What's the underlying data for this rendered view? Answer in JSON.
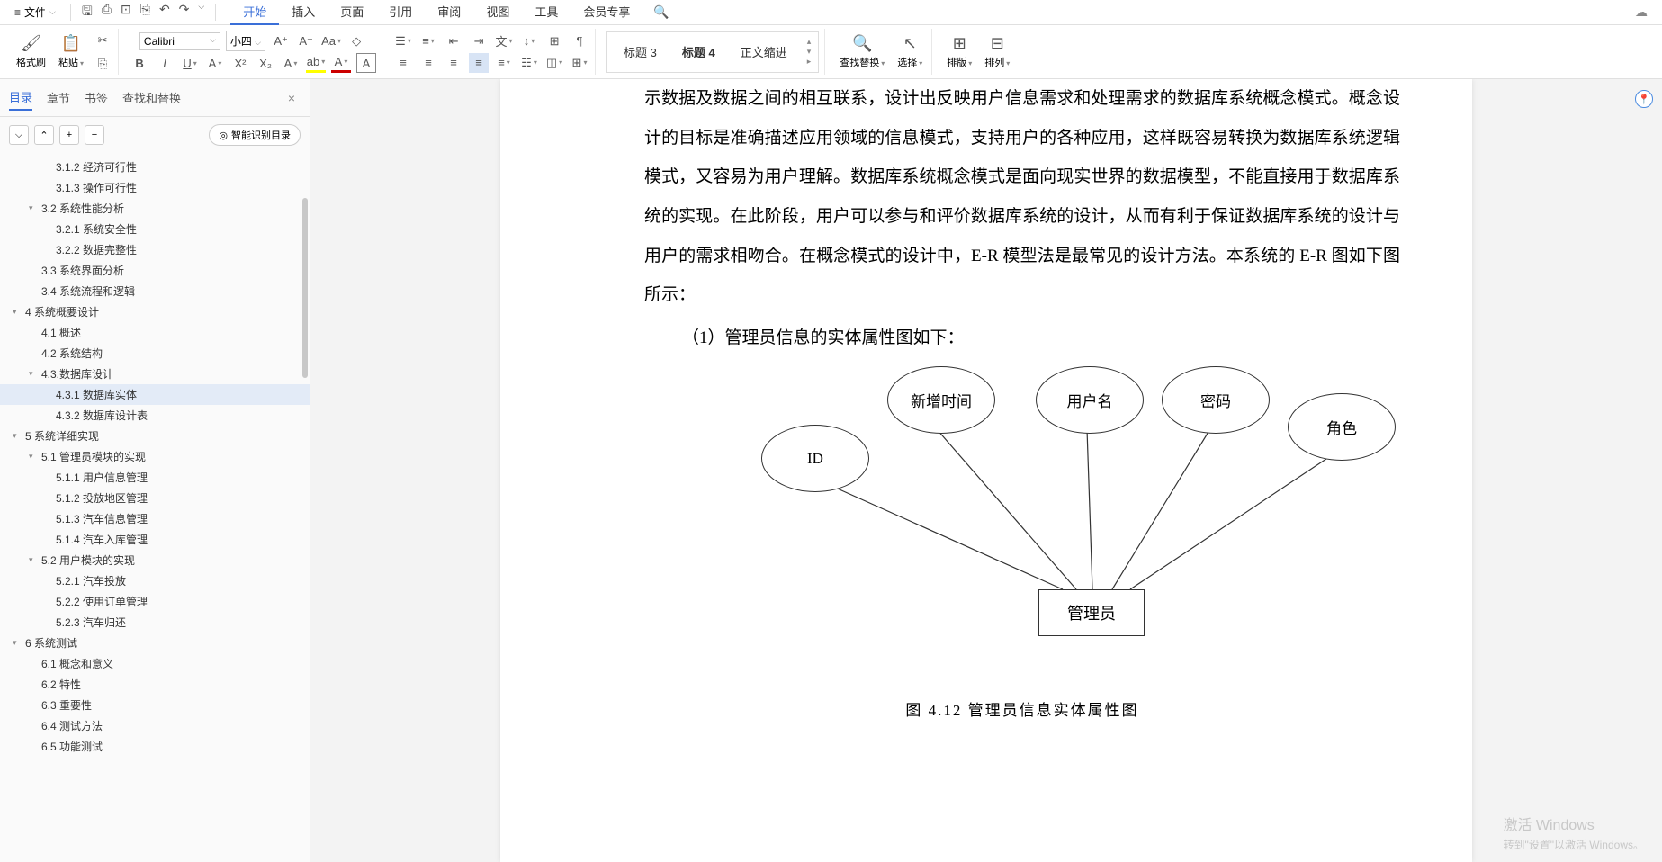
{
  "menubar": {
    "file": "文件",
    "tabs": [
      "开始",
      "插入",
      "页面",
      "引用",
      "审阅",
      "视图",
      "工具",
      "会员专享"
    ],
    "active_tab": 0
  },
  "ribbon": {
    "format_painter": "格式刷",
    "paste": "粘贴",
    "font_name": "Calibri",
    "font_size": "小四",
    "styles": [
      "标题 3",
      "标题 4",
      "正文缩进"
    ],
    "style_selected": 1,
    "find_replace": "查找替换",
    "select": "选择",
    "layout": "排版",
    "sort": "排列"
  },
  "sidebar": {
    "tabs": [
      "目录",
      "章节",
      "书签",
      "查找和替换"
    ],
    "active_tab": 0,
    "smart_btn": "智能识别目录",
    "toc": [
      {
        "level": 3,
        "label": "3.1.2 经济可行性"
      },
      {
        "level": 3,
        "label": "3.1.3 操作可行性"
      },
      {
        "level": 2,
        "label": "3.2 系统性能分析",
        "expand": true
      },
      {
        "level": 3,
        "label": "3.2.1 系统安全性"
      },
      {
        "level": 3,
        "label": "3.2.2 数据完整性"
      },
      {
        "level": 2,
        "label": "3.3 系统界面分析"
      },
      {
        "level": 2,
        "label": "3.4 系统流程和逻辑"
      },
      {
        "level": 1,
        "label": "4 系统概要设计",
        "expand": true
      },
      {
        "level": 2,
        "label": "4.1 概述"
      },
      {
        "level": 2,
        "label": "4.2 系统结构"
      },
      {
        "level": 2,
        "label": "4.3.数据库设计",
        "expand": true
      },
      {
        "level": 3,
        "label": "4.3.1 数据库实体",
        "selected": true
      },
      {
        "level": 3,
        "label": "4.3.2 数据库设计表"
      },
      {
        "level": 1,
        "label": "5 系统详细实现",
        "expand": true
      },
      {
        "level": 2,
        "label": "5.1  管理员模块的实现",
        "expand": true
      },
      {
        "level": 3,
        "label": "5.1.1 用户信息管理"
      },
      {
        "level": 3,
        "label": "5.1.2 投放地区管理"
      },
      {
        "level": 3,
        "label": "5.1.3 汽车信息管理"
      },
      {
        "level": 3,
        "label": "5.1.4 汽车入库管理"
      },
      {
        "level": 2,
        "label": "5.2  用户模块的实现",
        "expand": true
      },
      {
        "level": 3,
        "label": "5.2.1 汽车投放"
      },
      {
        "level": 3,
        "label": "5.2.2 使用订单管理"
      },
      {
        "level": 3,
        "label": "5.2.3 汽车归还"
      },
      {
        "level": 1,
        "label": "6 系统测试",
        "expand": true
      },
      {
        "level": 2,
        "label": "6.1 概念和意义"
      },
      {
        "level": 2,
        "label": "6.2 特性"
      },
      {
        "level": 2,
        "label": "6.3 重要性"
      },
      {
        "level": 2,
        "label": "6.4 测试方法"
      },
      {
        "level": 2,
        "label": "6.5 功能测试"
      }
    ]
  },
  "document": {
    "body_text": "示数据及数据之间的相互联系，设计出反映用户信息需求和处理需求的数据库系统概念模式。概念设计的目标是准确描述应用领域的信息模式，支持用户的各种应用，这样既容易转换为数据库系统逻辑模式，又容易为用户理解。数据库系统概念模式是面向现实世界的数据模型，不能直接用于数据库系统的实现。在此阶段，用户可以参与和评价数据库系统的设计，从而有利于保证数据库系统的设计与用户的需求相吻合。在概念模式的设计中，E-R 模型法是最常见的设计方法。本系统的 E-R 图如下图所示：",
    "subtitle": "（1）管理员信息的实体属性图如下：",
    "caption": "图 4.12   管理员信息实体属性图",
    "er": {
      "entity": "管理员",
      "attributes": [
        "ID",
        "新增时间",
        "用户名",
        "密码",
        "角色"
      ]
    }
  },
  "watermark": {
    "line1": "激活 Windows",
    "line2": "转到\"设置\"以激活 Windows。"
  }
}
